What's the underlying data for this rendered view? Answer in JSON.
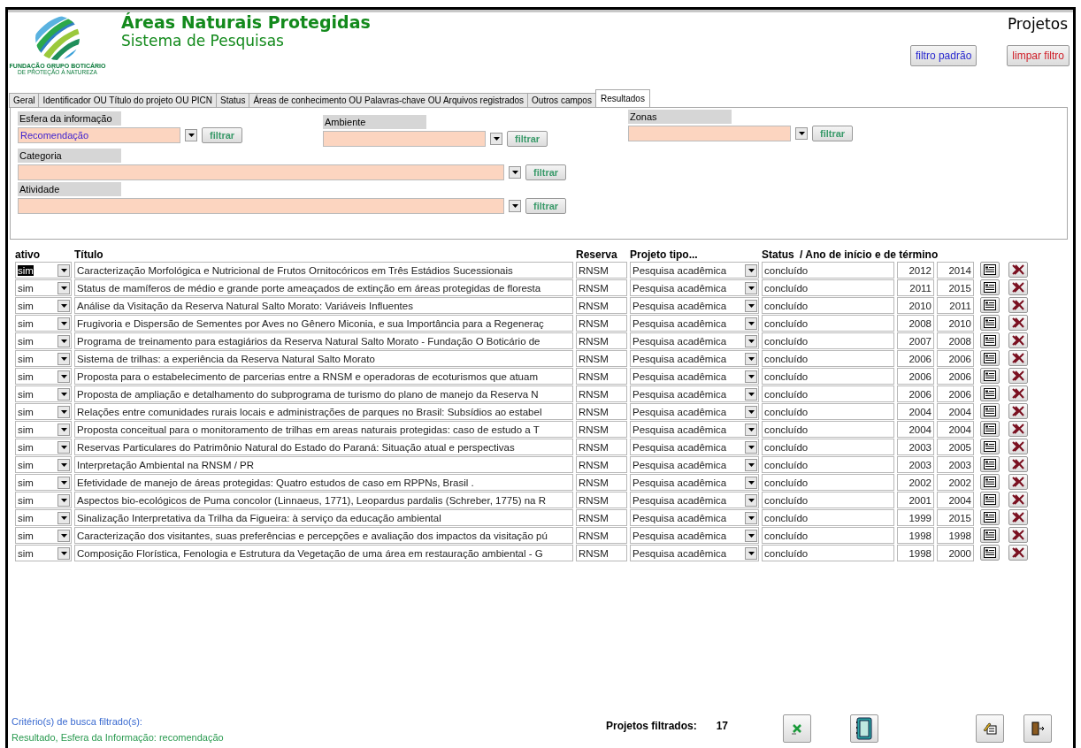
{
  "header": {
    "title": "Áreas Naturais Protegidas",
    "subtitle": "Sistema de Pesquisas",
    "logo_name": "FUNDAÇÃO GRUPO BOTICÁRIO",
    "logo_tagline": "DE PROTEÇÃO À NATUREZA",
    "form_title": "Projetos"
  },
  "buttons": [
    {
      "label": "filtro padrão",
      "kind": "default"
    },
    {
      "label": "limpar filtro",
      "kind": "clear"
    }
  ],
  "tabs": [
    {
      "label": "Geral",
      "selected": false
    },
    {
      "label": "Identificador OU Título do projeto OU PICN",
      "selected": false
    },
    {
      "label": "Status",
      "selected": false
    },
    {
      "label": "Áreas de conhecimento OU Palavras-chave OU Arquivos registrados",
      "selected": false
    },
    {
      "label": "Outros campos",
      "selected": false
    },
    {
      "label": "Resultados",
      "selected": true
    }
  ],
  "filter_rows": [
    [
      {
        "label": "Esfera da informação",
        "value": "Recomendação",
        "button": "filtrar",
        "kind": "short"
      },
      {
        "label": "Ambiente",
        "button": "filtrar",
        "kind": "short"
      },
      {
        "label": "Zonas",
        "button": "filtrar",
        "kind": "short"
      }
    ],
    [
      {
        "label": "Categoria",
        "button": "filtrar",
        "kind": "long"
      }
    ],
    [
      {
        "label": "Atividade",
        "button": "filtrar",
        "kind": "long"
      }
    ]
  ],
  "table": {
    "columns": [
      "ativo",
      "Título",
      "Reserva",
      "Projeto tipo...",
      "Status",
      "/ Ano de início e de término"
    ],
    "rows": [
      {
        "ativo": "sim",
        "selected": true,
        "title": "Caracterização Morfológica e Nutricional de Frutos Ornitocóricos em Três Estádios Sucessionais",
        "reserve": "RNSM",
        "type": "Pesquisa acadêmica",
        "status": "concluído",
        "start": "2012",
        "end": "2014"
      },
      {
        "ativo": "sim",
        "selected": false,
        "title": "Status de mamíferos de médio e grande porte ameaçados de extinção em áreas protegidas de floresta",
        "reserve": "RNSM",
        "type": "Pesquisa acadêmica",
        "status": "concluído",
        "start": "2011",
        "end": "2015"
      },
      {
        "ativo": "sim",
        "selected": false,
        "title": "Análise da Visitação da Reserva Natural Salto Morato: Variáveis Influentes",
        "reserve": "RNSM",
        "type": "Pesquisa acadêmica",
        "status": "concluído",
        "start": "2010",
        "end": "2011"
      },
      {
        "ativo": "sim",
        "selected": false,
        "title": "Frugivoria e Dispersão de Sementes por Aves no Gênero Miconia, e sua Importância para a Regeneraç",
        "reserve": "RNSM",
        "type": "Pesquisa acadêmica",
        "status": "concluído",
        "start": "2008",
        "end": "2010"
      },
      {
        "ativo": "sim",
        "selected": false,
        "title": "Programa de treinamento para estagiários da Reserva Natural Salto Morato - Fundação O Boticário de",
        "reserve": "RNSM",
        "type": "Pesquisa acadêmica",
        "status": "concluído",
        "start": "2007",
        "end": "2008"
      },
      {
        "ativo": "sim",
        "selected": false,
        "title": "Sistema de trilhas: a experiência da Reserva Natural Salto Morato",
        "reserve": "RNSM",
        "type": "Pesquisa acadêmica",
        "status": "concluído",
        "start": "2006",
        "end": "2006"
      },
      {
        "ativo": "sim",
        "selected": false,
        "title": "Proposta para o estabelecimento de parcerias entre a RNSM e operadoras de ecoturismos que atuam",
        "reserve": "RNSM",
        "type": "Pesquisa acadêmica",
        "status": "concluído",
        "start": "2006",
        "end": "2006"
      },
      {
        "ativo": "sim",
        "selected": false,
        "title": "Proposta de ampliação e detalhamento do subprograma de turismo do plano de manejo da Reserva N",
        "reserve": "RNSM",
        "type": "Pesquisa acadêmica",
        "status": "concluído",
        "start": "2006",
        "end": "2006"
      },
      {
        "ativo": "sim",
        "selected": false,
        "title": "Relações entre comunidades rurais locais e administrações de parques no Brasil: Subsídios ao estabel",
        "reserve": "RNSM",
        "type": "Pesquisa acadêmica",
        "status": "concluído",
        "start": "2004",
        "end": "2004"
      },
      {
        "ativo": "sim",
        "selected": false,
        "title": "Proposta conceitual para o monitoramento de trilhas em areas naturais protegidas: caso de estudo a T",
        "reserve": "RNSM",
        "type": "Pesquisa acadêmica",
        "status": "concluído",
        "start": "2004",
        "end": "2004"
      },
      {
        "ativo": "sim",
        "selected": false,
        "title": "Reservas Particulares do Patrimônio Natural do Estado do Paraná: Situação atual e perspectivas",
        "reserve": "RNSM",
        "type": "Pesquisa acadêmica",
        "status": "concluído",
        "start": "2003",
        "end": "2005"
      },
      {
        "ativo": "sim",
        "selected": false,
        "title": "Interpretação Ambiental na RNSM / PR",
        "reserve": "RNSM",
        "type": "Pesquisa acadêmica",
        "status": "concluído",
        "start": "2003",
        "end": "2003"
      },
      {
        "ativo": "sim",
        "selected": false,
        "title": "Efetividade de manejo de áreas protegidas: Quatro estudos de caso em RPPNs, Brasil .",
        "reserve": "RNSM",
        "type": "Pesquisa acadêmica",
        "status": "concluído",
        "start": "2002",
        "end": "2002"
      },
      {
        "ativo": "sim",
        "selected": false,
        "title": "Aspectos bio-ecológicos de Puma concolor (Linnaeus, 1771), Leopardus pardalis (Schreber, 1775) na R",
        "reserve": "RNSM",
        "type": "Pesquisa acadêmica",
        "status": "concluído",
        "start": "2001",
        "end": "2004"
      },
      {
        "ativo": "sim",
        "selected": false,
        "title": "Sinalização Interpretativa da Trilha da Figueira: à serviço da educação ambiental",
        "reserve": "RNSM",
        "type": "Pesquisa acadêmica",
        "status": "concluído",
        "start": "1999",
        "end": "2015"
      },
      {
        "ativo": "sim",
        "selected": false,
        "title": "Caracterização dos visitantes, suas preferências e percepções e avaliação dos impactos da visitação pú",
        "reserve": "RNSM",
        "type": "Pesquisa acadêmica",
        "status": "concluído",
        "start": "1998",
        "end": "1998"
      },
      {
        "ativo": "sim",
        "selected": false,
        "title": "Composição Florística, Fenologia e Estrutura da Vegetação de uma área em restauração ambiental - G",
        "reserve": "RNSM",
        "type": "Pesquisa acadêmica",
        "status": "concluído",
        "start": "1998",
        "end": "2000"
      }
    ]
  },
  "footer": {
    "criteria_label": "Critério(s) de busca filtrado(s):",
    "criteria": "Resultado, Esfera da Informação: recomendação",
    "count_label": "Projetos filtrados:",
    "count": "17"
  }
}
